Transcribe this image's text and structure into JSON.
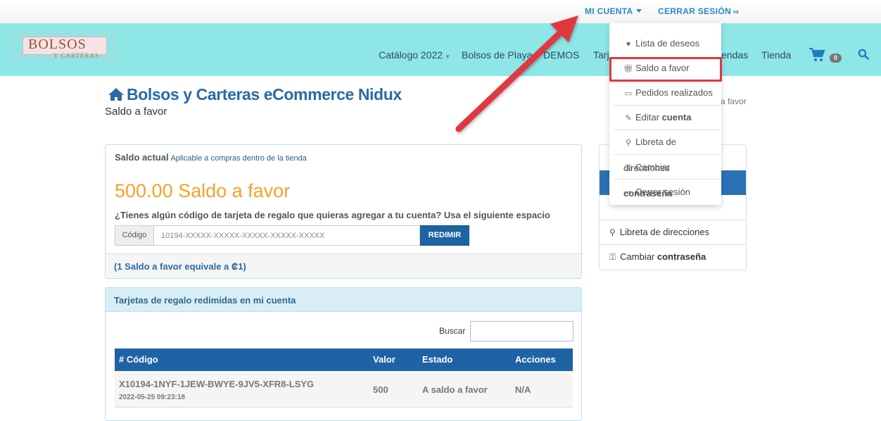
{
  "topbar": {
    "account_label": "MI CUENTA",
    "logout_label": "CERRAR SESIÓN",
    "logout_icon": "sign-out-icon"
  },
  "logo": {
    "line1": "BOLSOS",
    "line2": "Y CARTERAS"
  },
  "nav": {
    "items": [
      {
        "label": "Catálogo 2022",
        "has_caret": true
      },
      {
        "label": "Bolsos de Playa"
      },
      {
        "label": "DEMOS"
      },
      {
        "label": "Tarj"
      },
      {
        "label": "endas"
      },
      {
        "label": "Tienda"
      }
    ],
    "cart_count": "0",
    "cart_icon": "shopping-cart-icon",
    "search_icon": "search-icon"
  },
  "page": {
    "title": "Bolsos y Carteras eCommerce Nidux",
    "subtitle": "Saldo a favor",
    "home_icon": "home-icon"
  },
  "balance_panel": {
    "heading": "Saldo actual",
    "heading_note": "Aplicable a compras dentro de la tienda",
    "amount": "500.00 Saldo a favor",
    "question": "¿Tienes algún código de tarjeta de regalo que quieras agregar a tu cuenta? Usa el siguiente espacio",
    "code_label": "Código",
    "code_placeholder": "10194-XXXXX-XXXXX-XXXXX-XXXXX-XXXXX",
    "redeem_button": "REDIMIR",
    "footer": "(1 Saldo a favor equivale a ₡1)"
  },
  "giftcards_panel": {
    "heading": "Tarjetas de regalo redimidas en mi cuenta",
    "search_label": "Buscar",
    "columns": [
      "# Código",
      "Valor",
      "Estado",
      "Acciones"
    ],
    "rows": [
      {
        "code": "X10194-1NYF-1JEW-BWYE-9JV5-XFR8-LSYG",
        "date": "2022-05-25 09:23:18",
        "value": "500",
        "status": "A saldo a favor",
        "actions": "N/A"
      }
    ]
  },
  "sidebar": {
    "behind_text": "a favor",
    "items": [
      {
        "label": "Libreta de direcciones",
        "icon": "map-marker-icon"
      },
      {
        "label_pre": "Cambiar ",
        "label_bold": "contraseña",
        "icon": "key-icon"
      }
    ]
  },
  "dropdown": {
    "items": [
      {
        "label_pre": "Lista de deseos",
        "label_bold": "",
        "icon": "heart-icon"
      },
      {
        "label_pre": "Saldo a favor",
        "label_bold": "",
        "icon": "gift-icon",
        "highlighted": true
      },
      {
        "label_pre": "Pedidos realizados",
        "label_bold": "",
        "icon": "inbox-icon"
      },
      {
        "label_pre": "Editar ",
        "label_bold": "cuenta",
        "icon": "pencil-icon"
      },
      {
        "label_pre": "Libreta de direcciones",
        "label_bold": "",
        "icon": "map-marker-icon"
      },
      {
        "label_pre": "Cambiar ",
        "label_bold": "contraseña",
        "icon": "key-icon"
      },
      {
        "label_pre": "Cerrar sesión",
        "label_bold": "",
        "icon": "sign-out-icon"
      }
    ]
  },
  "colors": {
    "navbar_bg": "#8fe6e6",
    "primary": "#1e63a3",
    "amount": "#f5a12a",
    "annotation_arrow": "#e0393f"
  }
}
